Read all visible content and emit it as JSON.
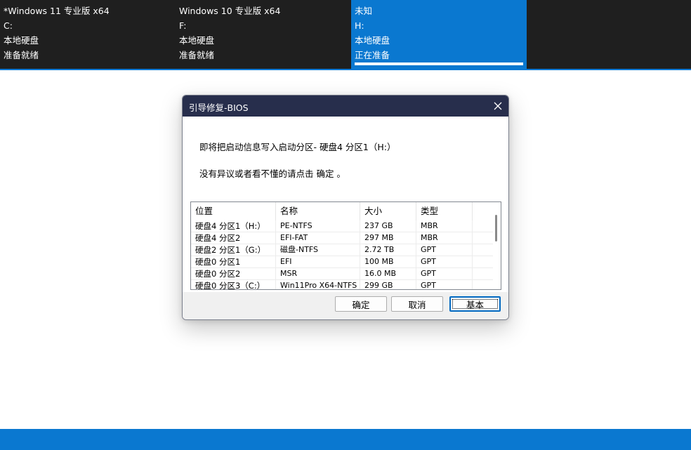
{
  "tiles": [
    {
      "os": "*Windows 11 专业版 x64",
      "drive": "C:",
      "type": "本地硬盘",
      "status": "准备就绪",
      "selected": false
    },
    {
      "os": "Windows 10 专业版 x64",
      "drive": "F:",
      "type": "本地硬盘",
      "status": "准备就绪",
      "selected": false
    },
    {
      "os": "未知",
      "drive": "H:",
      "type": "本地硬盘",
      "status": "正在准备",
      "selected": true
    }
  ],
  "dialog": {
    "title": "引导修复-BIOS",
    "close_icon": "close-icon",
    "message1": "即将把启动信息写入启动分区- 硬盘4 分区1（H:）",
    "message2": "没有异议或者看不懂的请点击 确定 。",
    "table": {
      "headers": [
        "位置",
        "名称",
        "大小",
        "类型"
      ],
      "rows": [
        [
          "硬盘4 分区1（H:）",
          "PE-NTFS",
          "237 GB",
          "MBR"
        ],
        [
          "硬盘4 分区2",
          "EFI-FAT",
          "297 MB",
          "MBR"
        ],
        [
          "硬盘2 分区1（G:）",
          "磁盘-NTFS",
          "2.72 TB",
          "GPT"
        ],
        [
          "硬盘0 分区1",
          "EFI",
          "100 MB",
          "GPT"
        ],
        [
          "硬盘0 分区2",
          "MSR",
          "16.0 MB",
          "GPT"
        ],
        [
          "硬盘0 分区3（C:）",
          "Win11Pro X64-NTFS",
          "299 GB",
          "GPT"
        ]
      ]
    },
    "buttons": {
      "ok": "确定",
      "cancel": "取消",
      "basic": "基本"
    }
  },
  "colors": {
    "accent": "#0a78d0",
    "topbar": "#1f1f1f",
    "titlebar": "#272e4c"
  }
}
